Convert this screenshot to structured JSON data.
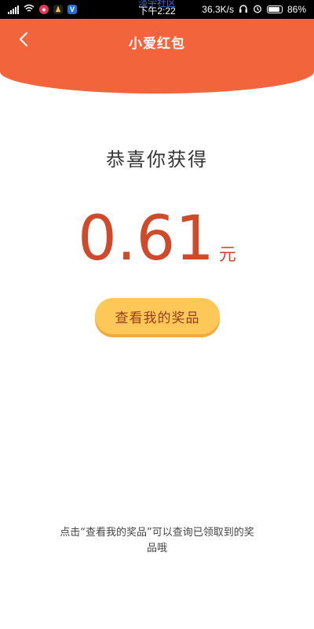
{
  "status_bar": {
    "time": "下午2:22",
    "watermark": "淡宇社区",
    "network_speed": "36.3K/s",
    "battery": "86%",
    "battery_level": 0.86
  },
  "header": {
    "title": "小爱红包",
    "background_color": "#f2643c"
  },
  "main": {
    "congrats_text": "恭喜你获得",
    "amount": "0.61",
    "unit": "元",
    "prize_button_label": "查看我的奖品",
    "hint": "点击“查看我的奖品”可以查询已领取到的奖品哦"
  }
}
